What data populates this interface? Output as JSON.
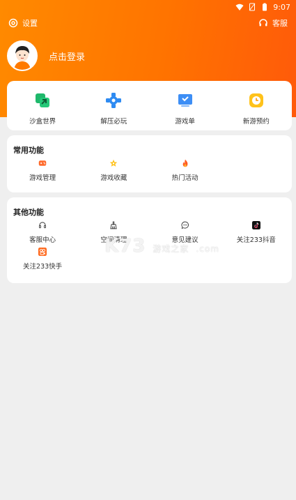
{
  "status_bar": {
    "time": "9:07"
  },
  "topbar": {
    "settings_label": "设置",
    "service_label": "客服"
  },
  "profile": {
    "login_label": "点击登录"
  },
  "main_menu": [
    {
      "label": "沙盒世界",
      "icon": "sandbox-icon"
    },
    {
      "label": "解压必玩",
      "icon": "relax-icon"
    },
    {
      "label": "游戏单",
      "icon": "gamelist-icon"
    },
    {
      "label": "新游预约",
      "icon": "reserve-icon"
    }
  ],
  "common": {
    "title": "常用功能",
    "items": [
      {
        "label": "游戏管理",
        "icon": "gamepad-icon"
      },
      {
        "label": "游戏收藏",
        "icon": "star-icon"
      },
      {
        "label": "热门活动",
        "icon": "flame-icon"
      }
    ]
  },
  "other": {
    "title": "其他功能",
    "items": [
      {
        "label": "客服中心",
        "icon": "headset-icon"
      },
      {
        "label": "空间清理",
        "icon": "broom-icon"
      },
      {
        "label": "意见建议",
        "icon": "chat-icon"
      },
      {
        "label": "关注233抖音",
        "icon": "tiktok-icon"
      },
      {
        "label": "关注233快手",
        "icon": "kuaishou-icon"
      }
    ]
  },
  "watermark": {
    "text": "K73",
    "sub": "游戏之家",
    "domain": ".com"
  },
  "colors": {
    "accent": "#ff7a00",
    "background": "#efefef",
    "card": "#ffffff"
  }
}
